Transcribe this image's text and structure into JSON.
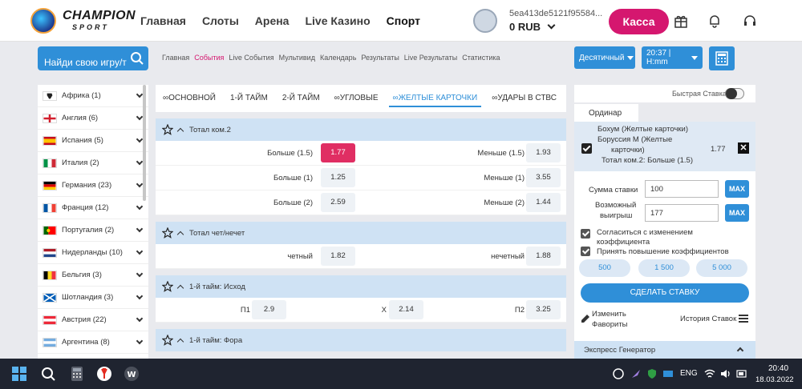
{
  "header": {
    "logo_top": "CHAMPION",
    "logo_bottom": "SPORT",
    "nav": [
      "Главная",
      "Слоты",
      "Арена",
      "Live Казино",
      "Спорт"
    ],
    "account_id": "5ea413de5121f95584...",
    "balance": "0 RUB",
    "cashier_label": "Касса"
  },
  "subbar": {
    "search_label": "Найди свою игру/т",
    "links": [
      "Главная",
      "События",
      "Live События",
      "Мультивид",
      "Календарь",
      "Результаты",
      "Live Результаты",
      "Статистика"
    ],
    "odds_format": "Десятичный",
    "time_format": "20:37 | H:mm"
  },
  "countries": [
    {
      "name": "Африка (1)"
    },
    {
      "name": "Англия (6)"
    },
    {
      "name": "Испания (5)"
    },
    {
      "name": "Италия (2)"
    },
    {
      "name": "Германия (23)"
    },
    {
      "name": "Франция (12)"
    },
    {
      "name": "Португалия (2)"
    },
    {
      "name": "Нидерланды (10)"
    },
    {
      "name": "Бельгия (3)"
    },
    {
      "name": "Шотландия (3)"
    },
    {
      "name": "Австрия (22)"
    },
    {
      "name": "Аргентина (8)"
    }
  ],
  "tabs": [
    "ОСНОВНОЙ",
    "1-Й ТАЙМ",
    "2-Й ТАЙМ",
    "УГЛОВЫЕ",
    "ЖЕЛТЫЕ КАРТОЧКИ",
    "УДАРЫ В СТВС"
  ],
  "markets": {
    "m1": {
      "title": "Тотал ком.2",
      "rows": [
        {
          "l1": "Больше (1.5)",
          "o1": "1.77",
          "l2": "Меньше (1.5)",
          "o2": "1.93"
        },
        {
          "l1": "Больше (1)",
          "o1": "1.25",
          "l2": "Меньше (1)",
          "o2": "3.55"
        },
        {
          "l1": "Больше (2)",
          "o1": "2.59",
          "l2": "Меньше (2)",
          "o2": "1.44"
        }
      ]
    },
    "m2": {
      "title": "Тотал чет/нечет",
      "l1": "четный",
      "o1": "1.82",
      "l2": "нечетный",
      "o2": "1.88"
    },
    "m3": {
      "title": "1-й тайм: Исход",
      "l1": "П1",
      "o1": "2.9",
      "l2": "Х",
      "o2": "2.14",
      "l3": "П2",
      "o3": "3.25"
    },
    "m4": {
      "title": "1-й тайм: Фора"
    }
  },
  "betslip": {
    "quick_bet_label": "Быстрая Ставка",
    "tab": "Ординар",
    "bet_line1": "Бохум (Желтые карточки)",
    "bet_line2": "Боруссия М (Желтые",
    "bet_line3": "карточки)",
    "bet_odds": "1.77",
    "bet_market": "Тотал ком.2: Больше (1.5)",
    "stake_label": "Сумма ставки",
    "stake_value": "100",
    "win_label1": "Возможный",
    "win_label2": "выигрыш",
    "win_value": "177",
    "max_label": "MAX",
    "agree_label1": "Согласиться с изменением",
    "agree_label2": "коэффициента",
    "accept_label": "Принять повышение коэффициентов",
    "amounts": [
      "500",
      "1 500",
      "5 000"
    ],
    "place_label": "СДЕЛАТЬ СТАВКУ",
    "fav_label1": "Изменить",
    "fav_label2": "Фавориты",
    "history_label": "История Ставок",
    "express_label": "Экспресс Генератор"
  },
  "taskbar": {
    "lang": "ENG",
    "time": "20:40",
    "date": "18.03.2022"
  }
}
